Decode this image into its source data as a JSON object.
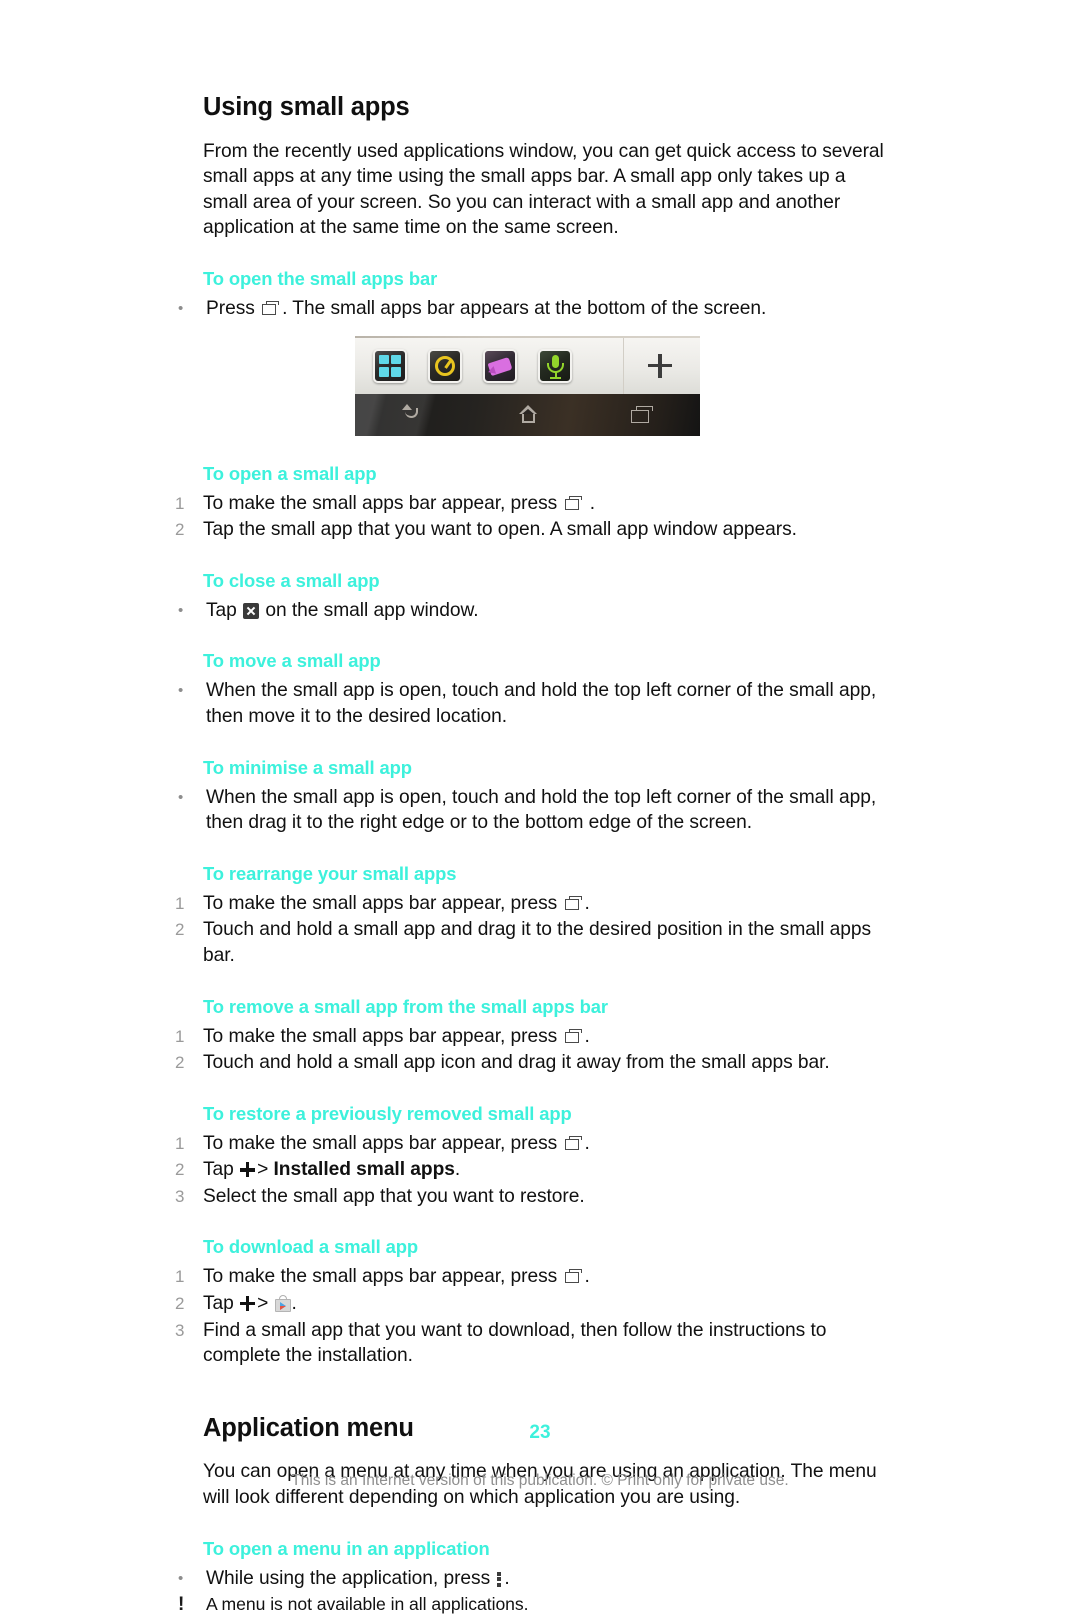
{
  "document": {
    "chapters": [
      {
        "title": "Using small apps",
        "intro": "From the recently used applications window, you can get quick access to several small apps at any time using the small apps bar. A small app only takes up a small area of your screen. So you can interact with a small app and another application at the same time on the same screen."
      },
      {
        "title": "Application menu",
        "intro": "You can open a menu at any time when you are using an application. The menu will look different depending on which application you are using."
      }
    ],
    "procedures": {
      "open_bar": {
        "heading": "To open the small apps bar",
        "bullet": "•",
        "text_before": "Press",
        "text_after": ". The small apps bar appears at the bottom of the screen."
      },
      "open_app": {
        "heading": "To open a small app",
        "step1_marker": "1",
        "step1_before": "To make the small apps bar appear, press",
        "step1_after": " .",
        "step2_marker": "2",
        "step2_text": "Tap the small app that you want to open. A small app window appears."
      },
      "close_app": {
        "heading": "To close a small app",
        "bullet": "•",
        "text_before": "Tap",
        "text_after": "on the small app window."
      },
      "move_app": {
        "heading": "To move a small app",
        "bullet": "•",
        "text": "When the small app is open, touch and hold the top left corner of the small app, then move it to the desired location."
      },
      "minimise_app": {
        "heading": "To minimise a small app",
        "bullet": "•",
        "text": "When the small app is open, touch and hold the top left corner of the small app, then drag it to the right edge or to the bottom edge of the screen."
      },
      "rearrange": {
        "heading": "To rearrange your small apps",
        "step1_marker": "1",
        "step1_before": "To make the small apps bar appear, press",
        "step1_after": ".",
        "step2_marker": "2",
        "step2_text": "Touch and hold a small app and drag it to the desired position in the small apps bar."
      },
      "remove": {
        "heading": "To remove a small app from the small apps bar",
        "step1_marker": "1",
        "step1_before": "To make the small apps bar appear, press",
        "step1_after": ".",
        "step2_marker": "2",
        "step2_text": "Touch and hold a small app icon and drag it away from the small apps bar."
      },
      "restore": {
        "heading": "To restore a previously removed small app",
        "step1_marker": "1",
        "step1_before": "To make the small apps bar appear, press",
        "step1_after": ".",
        "step2_marker": "2",
        "step2_before": "Tap",
        "step2_sep": ">",
        "step2_bold": "Installed small apps",
        "step2_after": ".",
        "step3_marker": "3",
        "step3_text": "Select the small app that you want to restore."
      },
      "download": {
        "heading": "To download a small app",
        "step1_marker": "1",
        "step1_before": "To make the small apps bar appear, press",
        "step1_after": ".",
        "step2_marker": "2",
        "step2_before": "Tap",
        "step2_sep": ">",
        "step2_after": ".",
        "step3_marker": "3",
        "step3_text": "Find a small app that you want to download, then follow the instructions to complete the installation."
      },
      "open_menu": {
        "heading": "To open a menu in an application",
        "bullet": "•",
        "text_before": "While using the application, press",
        "text_after": ".",
        "note_marker": "!",
        "note_text": "A menu is not available in all applications."
      }
    },
    "figure": {
      "alt": "small-apps-bar-screenshot",
      "apps": [
        {
          "name": "calculator-small-app-icon",
          "color": "#5fd8e8"
        },
        {
          "name": "timer-small-app-icon",
          "color": "#e8c51f"
        },
        {
          "name": "notes-small-app-icon",
          "color": "#d96fe0"
        },
        {
          "name": "voice-recorder-small-app-icon",
          "color": "#93d62b"
        }
      ],
      "add_button_label": "+",
      "nav_buttons": [
        "back-icon",
        "home-icon",
        "recent-apps-icon"
      ]
    },
    "footer": {
      "page_number": "23",
      "notice": "This is an Internet version of this publication. © Print only for private use."
    },
    "colors": {
      "accent": "#3df1dc",
      "text": "#111111",
      "muted": "#8e8e8e"
    }
  }
}
